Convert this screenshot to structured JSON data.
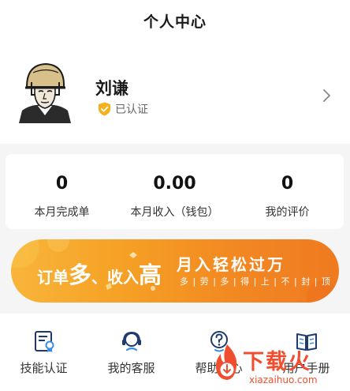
{
  "header": {
    "title": "个人中心"
  },
  "profile": {
    "name": "刘谦",
    "verified_label": "已认证"
  },
  "stats": [
    {
      "value": "0",
      "label": "本月完成单"
    },
    {
      "value": "0.00",
      "label": "本月收入（钱包）"
    },
    {
      "value": "0",
      "label": "我的评价"
    }
  ],
  "banner": {
    "part1": "订单",
    "part2": "多",
    "part3": "、收入",
    "part4": "高",
    "main": "月入轻松过万",
    "sub": "多 | 劳 | 多 | 得 | 上 | 不 | 封 | 顶"
  },
  "tools": [
    {
      "label": "技能认证",
      "icon": "certificate-icon"
    },
    {
      "label": "我的客服",
      "icon": "customer-service-icon"
    },
    {
      "label": "帮助中心",
      "icon": "help-icon"
    },
    {
      "label": "用户手册",
      "icon": "book-icon"
    }
  ],
  "watermark": {
    "text": "下载火",
    "url": "xiazaihuo.com"
  },
  "colors": {
    "accent": "#f39a26",
    "badge": "#f3b21b",
    "icon_blue": "#1e3a6e",
    "watermark": "#f04e2f"
  }
}
